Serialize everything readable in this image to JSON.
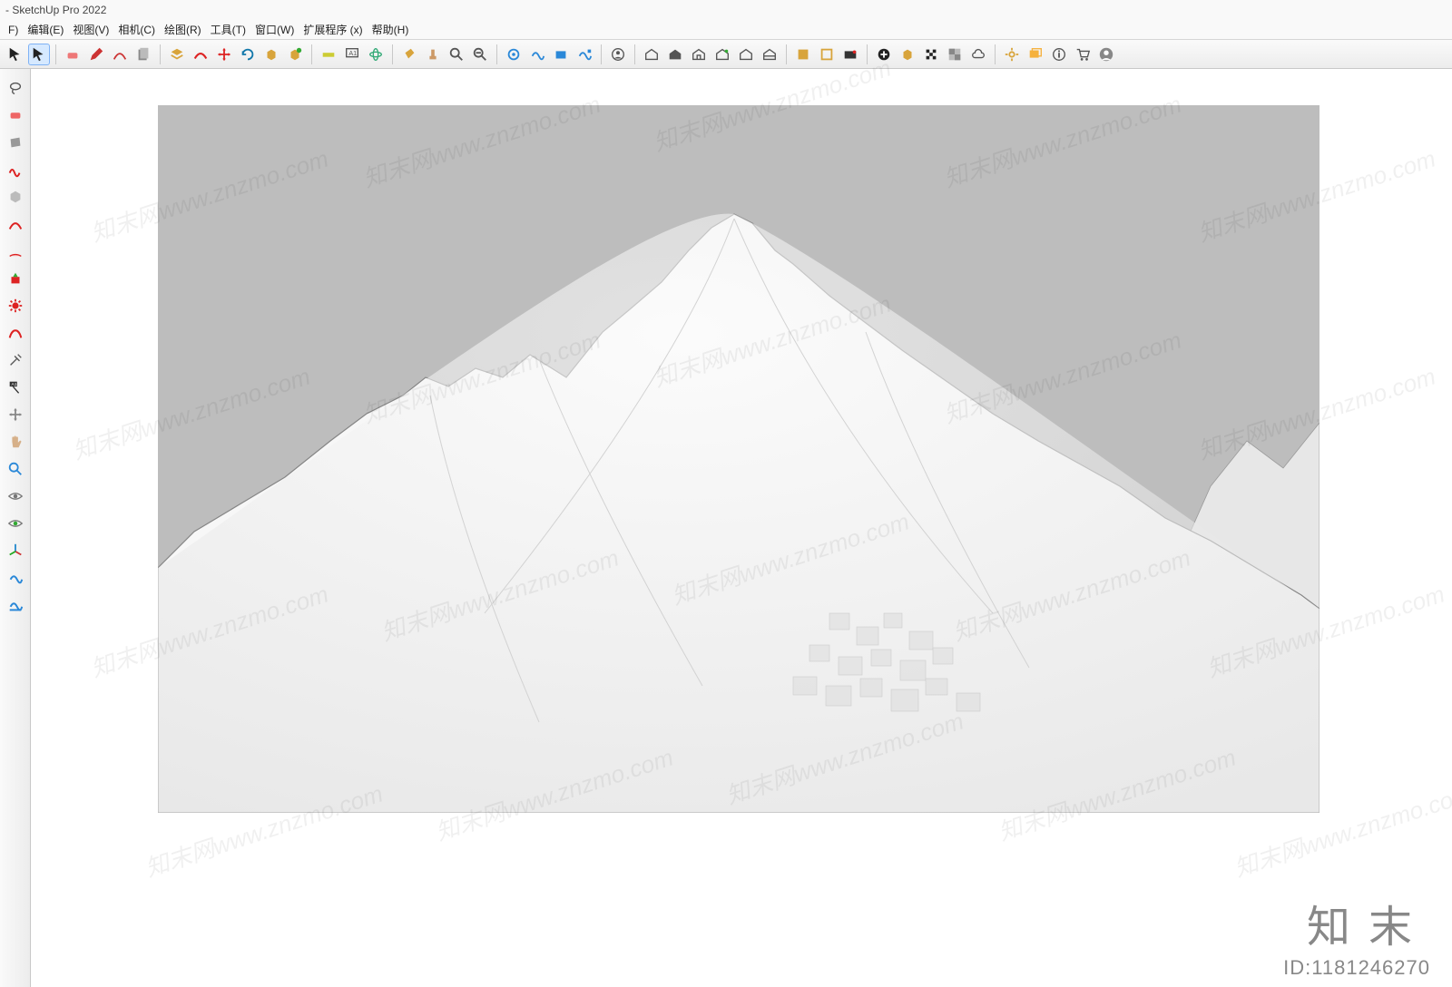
{
  "app": {
    "title": "- SketchUp Pro 2022"
  },
  "menu": {
    "items": [
      "F)",
      "编辑(E)",
      "视图(V)",
      "相机(C)",
      "绘图(R)",
      "工具(T)",
      "窗口(W)",
      "扩展程序 (x)",
      "帮助(H)"
    ]
  },
  "toolbar_main": {
    "groups": [
      [
        "cursor",
        "cursor2"
      ],
      [
        "eraser",
        "pencil",
        "arc",
        "sheet"
      ],
      [
        "stack",
        "red-curve",
        "move-4",
        "rotate",
        "cube-new",
        "cube-paste"
      ],
      [
        "tape",
        "text-box",
        "orbit"
      ],
      [
        "bucket",
        "stamp",
        "zoom-in",
        "zoom-out"
      ],
      [
        "plugin-a",
        "plugin-b",
        "plugin-c",
        "plugin-d"
      ],
      [
        "user-circle"
      ],
      [
        "warehouse1",
        "warehouse2",
        "warehouse3",
        "warehouse4",
        "warehouse5",
        "warehouse6"
      ],
      [
        "ext-a",
        "ext-b",
        "ext-c"
      ],
      [
        "record-plus",
        "record-cube",
        "flag-checker",
        "texture",
        "cloud"
      ],
      [
        "settings-gear",
        "window-layers",
        "info",
        "cart",
        "avatar"
      ]
    ],
    "selected": "cursor2"
  },
  "toolbar_side": {
    "items": [
      "lasso",
      "eraser-red",
      "quad-gray",
      "squiggle-red",
      "hexagon",
      "arc-red",
      "arc-red2",
      "push-red",
      "gear-red",
      "curve-red",
      "pin",
      "label-flag",
      "move-handle",
      "hand",
      "magnifier",
      "eye",
      "eye2",
      "axes",
      "section-blue",
      "section-blue2"
    ]
  },
  "viewport": {
    "content_label": "3D 地形模型（山体）"
  },
  "watermark": {
    "brand": "知末",
    "id_prefix": "ID:",
    "id": "1181246270",
    "tile_text": "知末网www.znzmo.com"
  },
  "colors": {
    "accent": "#2f7bd9",
    "toolbar_grad_top": "#fafafa",
    "toolbar_grad_bot": "#ececec",
    "sky": "#bdbdbd"
  }
}
